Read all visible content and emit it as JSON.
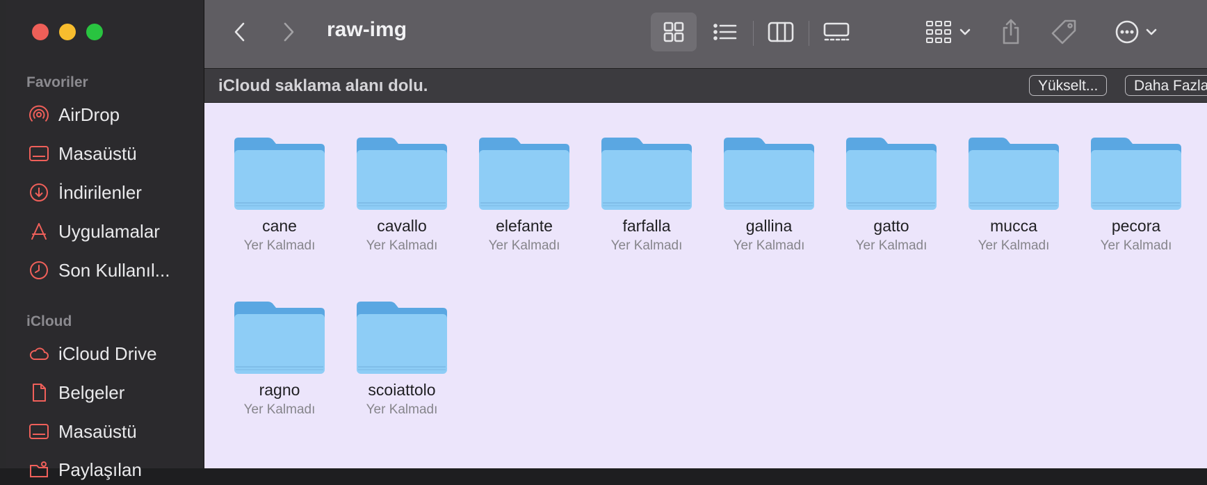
{
  "window": {
    "title": "raw-img"
  },
  "sidebar": {
    "sections": [
      {
        "title": "Favoriler",
        "items": [
          {
            "label": "AirDrop",
            "icon": "airdrop-icon"
          },
          {
            "label": "Masaüstü",
            "icon": "desktop-icon"
          },
          {
            "label": "İndirilenler",
            "icon": "downloads-icon"
          },
          {
            "label": "Uygulamalar",
            "icon": "applications-icon"
          },
          {
            "label": "Son Kullanıl...",
            "icon": "recents-icon"
          }
        ]
      },
      {
        "title": "iCloud",
        "items": [
          {
            "label": "iCloud Drive",
            "icon": "icloud-icon"
          },
          {
            "label": "Belgeler",
            "icon": "document-icon"
          },
          {
            "label": "Masaüstü",
            "icon": "desktop-icon"
          },
          {
            "label": "Paylaşılan",
            "icon": "shared-folder-icon"
          }
        ]
      }
    ]
  },
  "banner": {
    "text": "iCloud saklama alanı dolu.",
    "upgrade_label": "Yükselt...",
    "more_label": "Daha Fazla"
  },
  "folders": [
    {
      "name": "cane",
      "status": "Yer Kalmadı"
    },
    {
      "name": "cavallo",
      "status": "Yer Kalmadı"
    },
    {
      "name": "elefante",
      "status": "Yer Kalmadı"
    },
    {
      "name": "farfalla",
      "status": "Yer Kalmadı"
    },
    {
      "name": "gallina",
      "status": "Yer Kalmadı"
    },
    {
      "name": "gatto",
      "status": "Yer Kalmadı"
    },
    {
      "name": "mucca",
      "status": "Yer Kalmadı"
    },
    {
      "name": "pecora",
      "status": "Yer Kalmadı"
    },
    {
      "name": "ragno",
      "status": "Yer Kalmadı"
    },
    {
      "name": "scoiattolo",
      "status": "Yer Kalmadı"
    }
  ],
  "colors": {
    "sidebar_icon": "#f0605a",
    "folder_body": "#8ecdf6",
    "folder_tab": "#5aa7e2",
    "content_bg": "#ece5fb"
  }
}
